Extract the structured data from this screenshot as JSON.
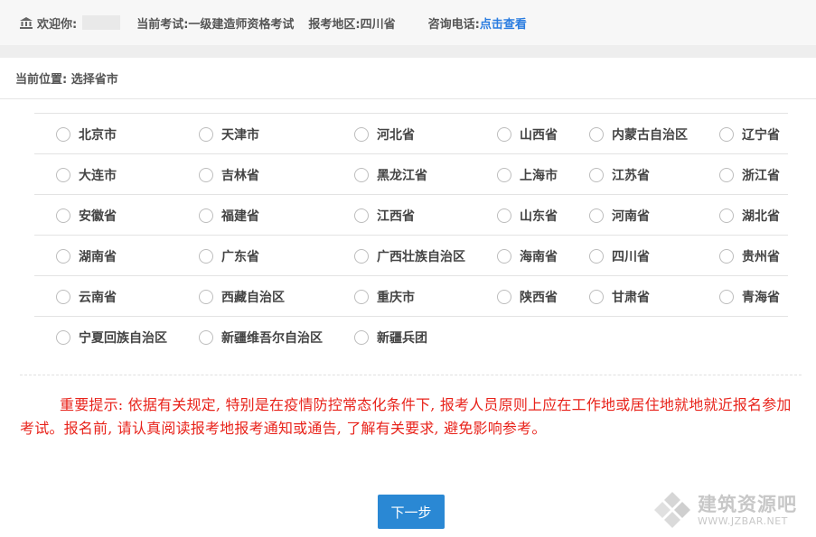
{
  "header": {
    "welcome_label": "欢迎你:",
    "exam_label": "当前考试:",
    "exam_value": "一级建造师资格考试",
    "region_label": "报考地区:",
    "region_value": "四川省",
    "phone_label": "咨询电话:",
    "phone_link": "点击查看"
  },
  "breadcrumb": {
    "text": "当前位置: 选择省市"
  },
  "provinces": {
    "row1": [
      "北京市",
      "天津市",
      "河北省",
      "山西省",
      "内蒙古自治区",
      "辽宁省"
    ],
    "row2": [
      "大连市",
      "吉林省",
      "黑龙江省",
      "上海市",
      "江苏省",
      "浙江省"
    ],
    "row3": [
      "安徽省",
      "福建省",
      "江西省",
      "山东省",
      "河南省",
      "湖北省"
    ],
    "row4": [
      "湖南省",
      "广东省",
      "广西壮族自治区",
      "海南省",
      "四川省",
      "贵州省"
    ],
    "row5": [
      "云南省",
      "西藏自治区",
      "重庆市",
      "陕西省",
      "甘肃省",
      "青海省"
    ],
    "row6": [
      "宁夏回族自治区",
      "新疆维吾尔自治区",
      "新疆兵团"
    ]
  },
  "notice": {
    "text": "重要提示: 依据有关规定, 特别是在疫情防控常态化条件下, 报考人员原则上应在工作地或居住地就地就近报名参加考试。报名前, 请认真阅读报考地报考通知或通告, 了解有关要求, 避免影响参考。"
  },
  "next_button": {
    "label": "下一步"
  },
  "watermark": {
    "cn": "建筑资源吧",
    "en": "WWW.JZBAR.NET"
  },
  "colors": {
    "notice": "#e8231b",
    "link": "#2b7de0",
    "button": "#2a88d4"
  }
}
